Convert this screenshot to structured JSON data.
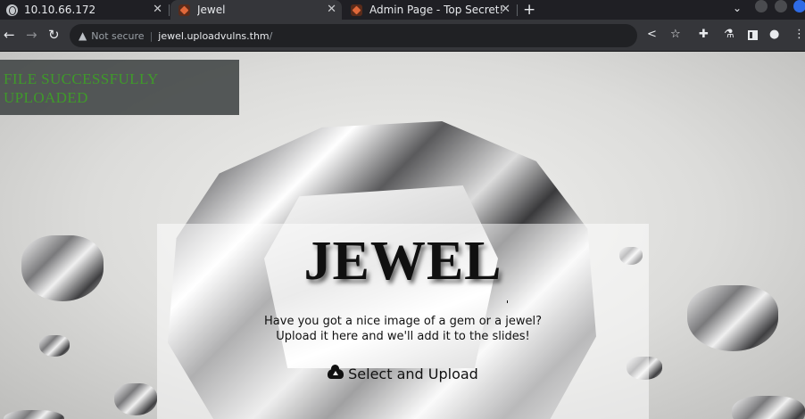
{
  "browser": {
    "tabs": [
      {
        "title": "10.10.66.172",
        "icon": "globe-icon",
        "active": false
      },
      {
        "title": "Jewel",
        "icon": "site-favicon",
        "active": true
      },
      {
        "title": "Admin Page - Top Secret!",
        "icon": "site-favicon",
        "active": false
      }
    ],
    "tab_close_glyph": "✕",
    "new_tab_glyph": "+",
    "address": {
      "security_label": "Not secure",
      "host": "jewel.uploadvulns.thm",
      "path": "/"
    }
  },
  "page": {
    "status_message": "File successfully uploaded",
    "logo_text": "JEWEL",
    "tagline_line1": "Have you got a nice image of a gem or a jewel?",
    "tagline_line2": "Upload it here and we'll add it to the slides!",
    "upload_button_label": "Select and Upload"
  },
  "colors": {
    "status_text": "#3f9a2a",
    "chrome_bg": "#35363a"
  }
}
